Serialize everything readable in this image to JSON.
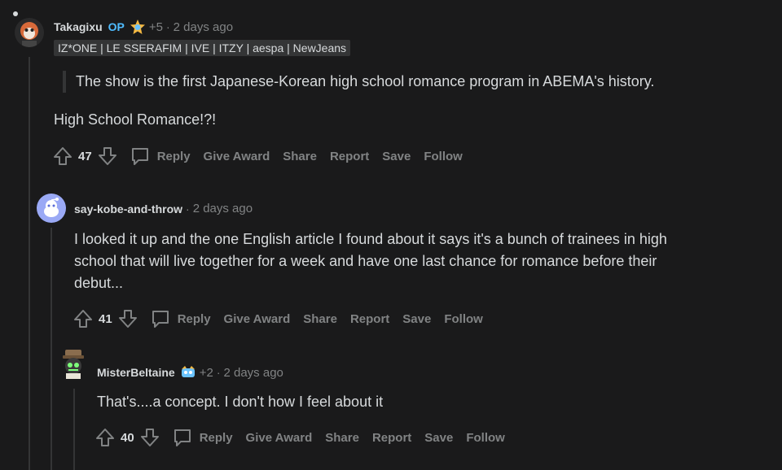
{
  "comments": [
    {
      "username": "Takagixu",
      "op_label": "OP",
      "award_count": "+5",
      "time": "2 days ago",
      "flair": "IZ*ONE | LE SSERAFIM | IVE | ITZY | aespa | NewJeans",
      "quote": "The show is the first Japanese-Korean high school romance program in ABEMA's history.",
      "text": "High School Romance!?!",
      "votes": "47"
    },
    {
      "username": "say-kobe-and-throw",
      "time": "2 days ago",
      "text_lines": [
        "I looked it up and the one English article I found about it says it's a bunch of trainees in high",
        "school that will live together for a week and have one last chance for romance before their",
        "debut..."
      ],
      "votes": "41"
    },
    {
      "username": "MisterBeltaine",
      "award_count": "+2",
      "time": "2 days ago",
      "text": "That's....a concept. I don't how I feel about it",
      "votes": "40"
    }
  ],
  "actions": {
    "reply": "Reply",
    "give_award": "Give Award",
    "share": "Share",
    "report": "Report",
    "save": "Save",
    "follow": "Follow"
  },
  "header_separator": "·",
  "colors": {
    "background": "#1a1a1b",
    "text": "#d7dadc",
    "muted": "#818384",
    "op": "#4fbcff",
    "flair_bg": "#343536",
    "thread_line": "#343536"
  },
  "icons": [
    "upvote-icon",
    "downvote-icon",
    "comment-bubble-icon",
    "award-icon",
    "avatar-icon"
  ]
}
